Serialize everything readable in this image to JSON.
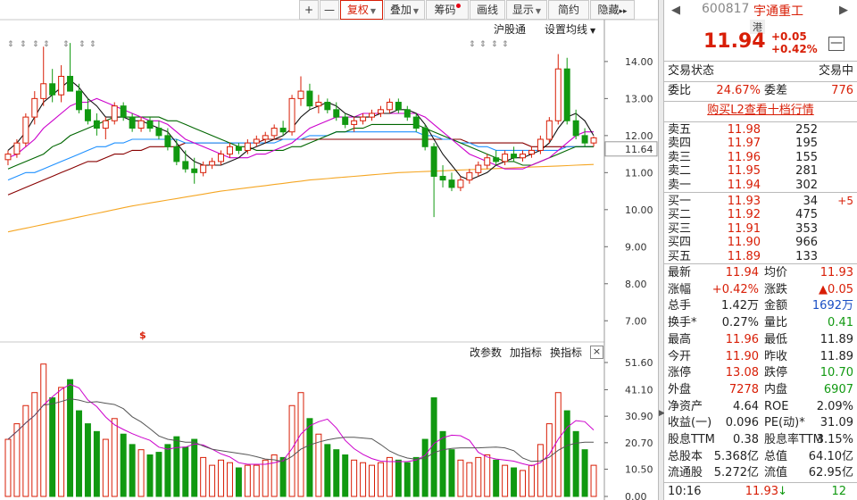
{
  "toolbar": {
    "buttons": [
      "+",
      "—",
      "复权",
      "叠加",
      "筹码",
      "画线",
      "显示",
      "简约",
      "隐藏"
    ],
    "more": "▸▸"
  },
  "chart_header": {
    "links": [
      "沪股通",
      "设置均线"
    ]
  },
  "indicator_header": {
    "links": [
      "改参数",
      "加指标",
      "换指标"
    ],
    "close": "×"
  },
  "price_axis": [
    "14.00",
    "13.00",
    "12.00",
    "11.00",
    "10.00",
    "9.00",
    "8.00",
    "7.00"
  ],
  "last_price_label": "11.64",
  "dividend_marker": "$",
  "volume_axis": [
    "51.60",
    "41.10",
    "30.90",
    "20.70",
    "10.50",
    "0.00"
  ],
  "colors": {
    "up": "#d81e06",
    "down": "#119911",
    "ma5": "#111111",
    "ma10": "#cc00cc",
    "ma20": "#006600",
    "ma30": "#1e90ff",
    "ma60": "#880000",
    "ma120": "#f5a623"
  },
  "chart_data": {
    "type": "candlestick",
    "price_ylim": [
      6.5,
      14.6
    ],
    "volume_ylim": [
      0,
      51.6
    ],
    "candles": [
      [
        11.35,
        11.6,
        11.2,
        11.5,
        22
      ],
      [
        11.5,
        11.9,
        11.4,
        11.8,
        28
      ],
      [
        11.8,
        12.6,
        11.7,
        12.5,
        35
      ],
      [
        12.5,
        13.2,
        12.3,
        13.0,
        40
      ],
      [
        13.0,
        14.4,
        12.8,
        13.4,
        51
      ],
      [
        13.4,
        13.8,
        12.9,
        13.1,
        38
      ],
      [
        13.1,
        13.9,
        12.9,
        13.6,
        42
      ],
      [
        13.6,
        14.5,
        13.3,
        13.2,
        45
      ],
      [
        13.2,
        13.4,
        12.6,
        12.7,
        33
      ],
      [
        12.7,
        13.0,
        12.3,
        12.4,
        28
      ],
      [
        12.4,
        12.6,
        12.0,
        12.2,
        25
      ],
      [
        12.2,
        12.5,
        11.9,
        12.4,
        22
      ],
      [
        12.4,
        12.9,
        12.3,
        12.8,
        30
      ],
      [
        12.8,
        12.9,
        12.4,
        12.5,
        24
      ],
      [
        12.5,
        12.6,
        12.1,
        12.2,
        20
      ],
      [
        12.2,
        12.5,
        12.1,
        12.4,
        18
      ],
      [
        12.4,
        12.5,
        12.1,
        12.2,
        16
      ],
      [
        12.2,
        12.4,
        11.9,
        12.0,
        17
      ],
      [
        12.0,
        12.2,
        11.6,
        11.7,
        20
      ],
      [
        11.7,
        11.9,
        11.2,
        11.3,
        23
      ],
      [
        11.3,
        11.6,
        11.0,
        11.1,
        19
      ],
      [
        11.1,
        11.4,
        10.7,
        11.0,
        22
      ],
      [
        11.0,
        11.3,
        10.9,
        11.2,
        15
      ],
      [
        11.2,
        11.4,
        11.1,
        11.3,
        12
      ],
      [
        11.3,
        11.6,
        11.2,
        11.5,
        14
      ],
      [
        11.5,
        11.8,
        11.4,
        11.7,
        13
      ],
      [
        11.7,
        11.8,
        11.5,
        11.6,
        11
      ],
      [
        11.6,
        11.9,
        11.5,
        11.8,
        12
      ],
      [
        11.8,
        12.0,
        11.7,
        11.9,
        12
      ],
      [
        11.9,
        12.1,
        11.8,
        12.0,
        14
      ],
      [
        12.0,
        12.3,
        11.9,
        12.2,
        16
      ],
      [
        12.2,
        12.4,
        12.0,
        12.1,
        15
      ],
      [
        12.1,
        13.1,
        12.0,
        13.0,
        35
      ],
      [
        13.0,
        13.6,
        12.8,
        13.2,
        40
      ],
      [
        13.2,
        13.4,
        12.7,
        12.8,
        30
      ],
      [
        12.8,
        13.1,
        12.6,
        12.9,
        24
      ],
      [
        12.9,
        13.0,
        12.6,
        12.7,
        20
      ],
      [
        12.7,
        12.9,
        12.4,
        12.5,
        18
      ],
      [
        12.5,
        12.6,
        12.2,
        12.3,
        16
      ],
      [
        12.3,
        12.5,
        12.1,
        12.4,
        14
      ],
      [
        12.4,
        12.6,
        12.3,
        12.5,
        13
      ],
      [
        12.5,
        12.7,
        12.4,
        12.6,
        12
      ],
      [
        12.6,
        12.8,
        12.5,
        12.7,
        13
      ],
      [
        12.7,
        13.0,
        12.6,
        12.9,
        15
      ],
      [
        12.9,
        13.0,
        12.6,
        12.7,
        14
      ],
      [
        12.7,
        12.8,
        12.4,
        12.5,
        13
      ],
      [
        12.5,
        12.6,
        12.1,
        12.2,
        15
      ],
      [
        12.2,
        12.3,
        11.6,
        11.7,
        22
      ],
      [
        11.7,
        11.8,
        9.8,
        10.9,
        38
      ],
      [
        10.9,
        11.2,
        10.6,
        10.8,
        25
      ],
      [
        10.8,
        11.0,
        10.5,
        10.6,
        18
      ],
      [
        10.6,
        10.9,
        10.5,
        10.8,
        14
      ],
      [
        10.8,
        11.1,
        10.7,
        11.0,
        13
      ],
      [
        11.0,
        11.3,
        10.9,
        11.2,
        15
      ],
      [
        11.2,
        11.5,
        11.1,
        11.4,
        16
      ],
      [
        11.4,
        11.6,
        11.2,
        11.3,
        14
      ],
      [
        11.3,
        11.6,
        11.2,
        11.5,
        12
      ],
      [
        11.5,
        11.7,
        11.3,
        11.4,
        11
      ],
      [
        11.4,
        11.6,
        11.3,
        11.5,
        10
      ],
      [
        11.5,
        11.7,
        11.4,
        11.6,
        12
      ],
      [
        11.6,
        12.0,
        11.5,
        11.9,
        20
      ],
      [
        11.9,
        12.5,
        11.8,
        12.4,
        28
      ],
      [
        12.4,
        14.2,
        12.3,
        13.8,
        40
      ],
      [
        13.8,
        14.1,
        12.3,
        12.4,
        33
      ],
      [
        12.4,
        12.7,
        11.9,
        12.0,
        25
      ],
      [
        12.0,
        12.2,
        11.7,
        11.8,
        18
      ],
      [
        11.8,
        11.98,
        11.7,
        11.94,
        12
      ]
    ],
    "ma5": [
      11.6,
      11.8,
      12.1,
      12.5,
      12.9,
      13.1,
      13.3,
      13.5,
      13.3,
      13.0,
      12.8,
      12.5,
      12.5,
      12.5,
      12.4,
      12.4,
      12.3,
      12.2,
      12.1,
      11.8,
      11.5,
      11.3,
      11.2,
      11.2,
      11.2,
      11.3,
      11.4,
      11.6,
      11.7,
      11.8,
      11.9,
      12.0,
      12.2,
      12.5,
      12.7,
      12.8,
      12.9,
      12.8,
      12.6,
      12.5,
      12.5,
      12.5,
      12.6,
      12.6,
      12.7,
      12.7,
      12.6,
      12.3,
      11.9,
      11.5,
      11.2,
      10.9,
      10.8,
      10.9,
      11.0,
      11.2,
      11.3,
      11.4,
      11.4,
      11.5,
      11.6,
      11.8,
      12.2,
      12.5,
      12.6,
      12.4,
      12.0
    ],
    "ma10": [
      11.4,
      11.5,
      11.7,
      11.9,
      12.2,
      12.4,
      12.6,
      12.8,
      12.9,
      12.9,
      13.0,
      12.9,
      12.8,
      12.7,
      12.6,
      12.5,
      12.4,
      12.4,
      12.3,
      12.1,
      11.9,
      11.8,
      11.7,
      11.6,
      11.5,
      11.4,
      11.4,
      11.4,
      11.5,
      11.5,
      11.6,
      11.7,
      11.8,
      12.0,
      12.2,
      12.3,
      12.4,
      12.5,
      12.5,
      12.5,
      12.6,
      12.6,
      12.6,
      12.6,
      12.6,
      12.6,
      12.6,
      12.5,
      12.3,
      12.1,
      11.9,
      11.7,
      11.5,
      11.4,
      11.3,
      11.2,
      11.1,
      11.1,
      11.1,
      11.2,
      11.3,
      11.4,
      11.6,
      11.8,
      12.0,
      12.1,
      12.1
    ],
    "ma20": [
      11.1,
      11.2,
      11.3,
      11.4,
      11.5,
      11.7,
      11.8,
      12.0,
      12.1,
      12.2,
      12.3,
      12.4,
      12.5,
      12.5,
      12.5,
      12.5,
      12.5,
      12.5,
      12.4,
      12.4,
      12.3,
      12.2,
      12.1,
      12.0,
      11.9,
      11.8,
      11.7,
      11.7,
      11.6,
      11.6,
      11.6,
      11.6,
      11.7,
      11.7,
      11.8,
      11.9,
      12.0,
      12.1,
      12.1,
      12.2,
      12.2,
      12.3,
      12.3,
      12.3,
      12.3,
      12.3,
      12.3,
      12.2,
      12.1,
      12.0,
      11.9,
      11.8,
      11.7,
      11.6,
      11.5,
      11.4,
      11.3,
      11.3,
      11.2,
      11.2,
      11.3,
      11.4,
      11.5,
      11.6,
      11.7,
      11.7,
      11.7
    ],
    "ma30": [
      10.8,
      10.9,
      11.0,
      11.0,
      11.1,
      11.2,
      11.3,
      11.4,
      11.5,
      11.6,
      11.7,
      11.7,
      11.8,
      11.8,
      11.9,
      11.9,
      11.9,
      11.9,
      11.9,
      11.9,
      11.8,
      11.8,
      11.8,
      11.8,
      11.8,
      11.8,
      11.8,
      11.8,
      11.8,
      11.8,
      11.8,
      11.9,
      11.9,
      11.9,
      12.0,
      12.0,
      12.0,
      12.1,
      12.1,
      12.1,
      12.1,
      12.1,
      12.1,
      12.1,
      12.1,
      12.1,
      12.1,
      12.0,
      12.0,
      11.9,
      11.9,
      11.8,
      11.8,
      11.7,
      11.7,
      11.6,
      11.6,
      11.6,
      11.6,
      11.6,
      11.6,
      11.6,
      11.6,
      11.7,
      11.7,
      11.7,
      11.7
    ],
    "ma60": [
      10.4,
      10.5,
      10.6,
      10.7,
      10.8,
      10.9,
      11.0,
      11.1,
      11.2,
      11.3,
      11.3,
      11.4,
      11.5,
      11.5,
      11.6,
      11.6,
      11.7,
      11.7,
      11.7,
      11.7,
      11.8,
      11.8,
      11.8,
      11.8,
      11.8,
      11.8,
      11.8,
      11.8,
      11.8,
      11.9,
      11.9,
      11.9,
      11.9,
      11.9,
      11.9,
      11.9,
      11.9,
      11.9,
      11.9,
      11.9,
      11.9,
      11.9,
      11.9,
      11.9,
      11.9,
      11.9,
      11.9,
      11.9,
      11.9,
      11.9,
      11.9,
      11.9,
      11.8,
      11.8,
      11.8,
      11.8,
      11.8,
      11.8,
      11.8,
      11.7,
      11.7,
      11.7,
      11.7,
      11.7,
      11.7,
      11.7,
      11.7
    ],
    "ma120": [
      9.4,
      9.45,
      9.5,
      9.55,
      9.6,
      9.65,
      9.7,
      9.75,
      9.8,
      9.85,
      9.9,
      9.95,
      10.0,
      10.05,
      10.1,
      10.14,
      10.18,
      10.22,
      10.26,
      10.3,
      10.34,
      10.38,
      10.42,
      10.46,
      10.5,
      10.53,
      10.56,
      10.59,
      10.62,
      10.65,
      10.68,
      10.71,
      10.74,
      10.77,
      10.8,
      10.82,
      10.84,
      10.86,
      10.88,
      10.9,
      10.92,
      10.94,
      10.96,
      10.98,
      11.0,
      11.01,
      11.02,
      11.03,
      11.04,
      11.05,
      11.06,
      11.07,
      11.08,
      11.09,
      11.1,
      11.11,
      11.12,
      11.13,
      11.14,
      11.15,
      11.16,
      11.17,
      11.18,
      11.19,
      11.2,
      11.21,
      11.22
    ]
  },
  "panel": {
    "nav_left": "◀",
    "nav_right": "▶",
    "code": "600817",
    "name": "宇通重工",
    "hk_tag": "港",
    "price": "11.94",
    "change": "+0.05",
    "change_pct": "+0.42%",
    "minus": "—",
    "status_label": "交易状态",
    "status_value": "交易中",
    "weibi_label": "委比",
    "weibi_value": "24.67%",
    "weicha_label": "委差",
    "weicha_value": "776",
    "l2_link": "购买L2查看十档行情",
    "asks": [
      {
        "label": "卖五",
        "price": "11.98",
        "vol": "252"
      },
      {
        "label": "卖四",
        "price": "11.97",
        "vol": "195"
      },
      {
        "label": "卖三",
        "price": "11.96",
        "vol": "155"
      },
      {
        "label": "卖二",
        "price": "11.95",
        "vol": "281"
      },
      {
        "label": "卖一",
        "price": "11.94",
        "vol": "302"
      }
    ],
    "bids": [
      {
        "label": "买一",
        "price": "11.93",
        "vol": "34",
        "extra": "+5"
      },
      {
        "label": "买二",
        "price": "11.92",
        "vol": "475",
        "extra": ""
      },
      {
        "label": "买三",
        "price": "11.91",
        "vol": "353",
        "extra": ""
      },
      {
        "label": "买四",
        "price": "11.90",
        "vol": "966",
        "extra": ""
      },
      {
        "label": "买五",
        "price": "11.89",
        "vol": "133",
        "extra": ""
      }
    ],
    "quotes": [
      {
        "l1": "最新",
        "v1": "11.94",
        "c1": "red",
        "l2": "均价",
        "v2": "11.93",
        "c2": "red"
      },
      {
        "l1": "涨幅",
        "v1": "+0.42%",
        "c1": "red",
        "l2": "涨跌",
        "v2": "▲0.05",
        "c2": "red"
      },
      {
        "l1": "总手",
        "v1": "1.42万",
        "c1": "",
        "l2": "金额",
        "v2": "1692万",
        "c2": "blue"
      },
      {
        "l1": "换手*",
        "v1": "0.27%",
        "c1": "",
        "l2": "量比",
        "v2": "0.41",
        "c2": "green"
      },
      {
        "l1": "最高",
        "v1": "11.96",
        "c1": "red",
        "l2": "最低",
        "v2": "11.89",
        "c2": ""
      },
      {
        "l1": "今开",
        "v1": "11.90",
        "c1": "red",
        "l2": "昨收",
        "v2": "11.89",
        "c2": ""
      },
      {
        "l1": "涨停",
        "v1": "13.08",
        "c1": "red",
        "l2": "跌停",
        "v2": "10.70",
        "c2": "green"
      },
      {
        "l1": "外盘",
        "v1": "7278",
        "c1": "red",
        "l2": "内盘",
        "v2": "6907",
        "c2": "green"
      },
      {
        "l1": "净资产",
        "v1": "4.64",
        "c1": "",
        "l2": "ROE",
        "v2": "2.09%",
        "c2": ""
      },
      {
        "l1": "收益(一)",
        "v1": "0.096",
        "c1": "",
        "l2": "PE(动)*",
        "v2": "31.09",
        "c2": ""
      },
      {
        "l1": "股息TTM",
        "v1": "0.38",
        "c1": "",
        "l2": "股息率TTM",
        "v2": "3.15%",
        "c2": ""
      },
      {
        "l1": "总股本",
        "v1": "5.368亿",
        "c1": "",
        "l2": "总值",
        "v2": "64.10亿",
        "c2": ""
      },
      {
        "l1": "流通股",
        "v1": "5.272亿",
        "c1": "",
        "l2": "流值",
        "v2": "62.95亿",
        "c2": ""
      }
    ],
    "footer": {
      "time": "10:16",
      "price": "11.93",
      "arrow": "↓",
      "vol": "12"
    }
  }
}
